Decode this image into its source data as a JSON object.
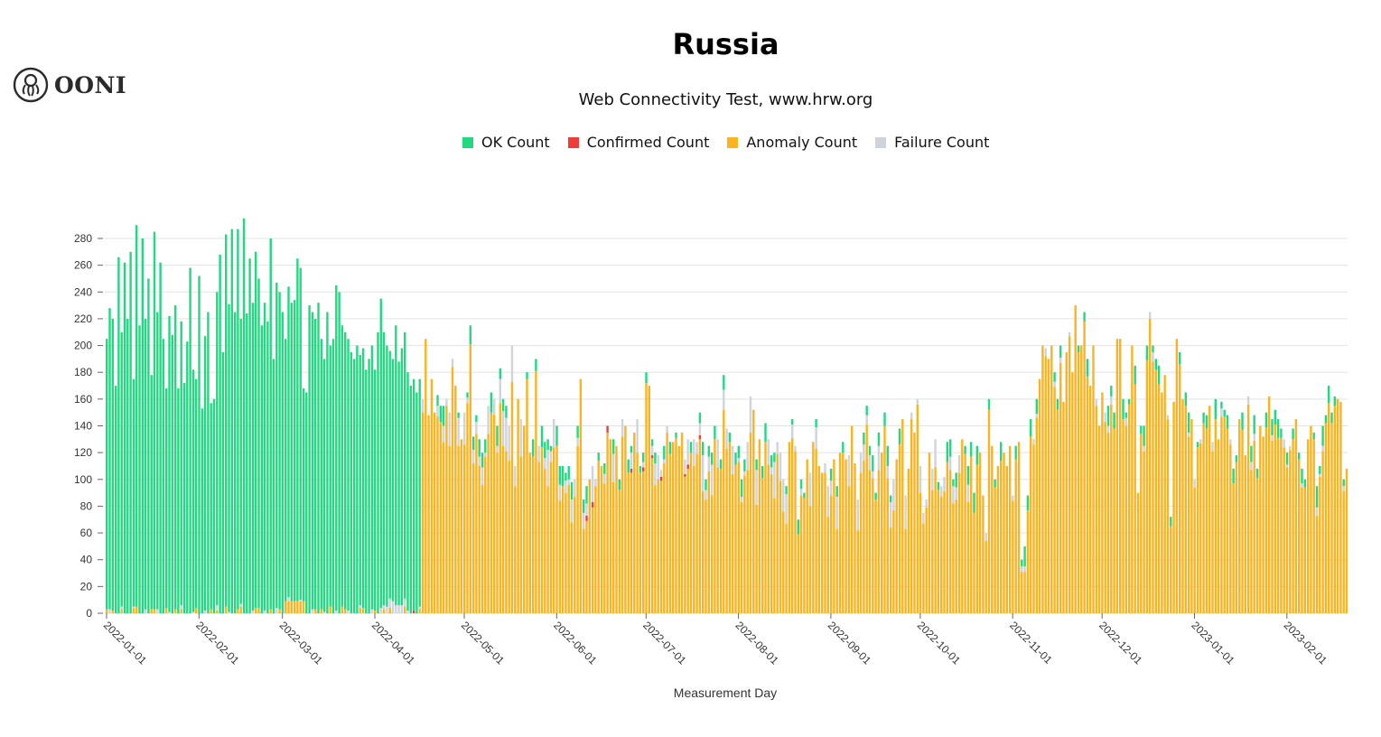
{
  "brand": {
    "name": "OONI",
    "icon": "octopus-logo-icon"
  },
  "chart_data": {
    "type": "bar",
    "stacked": true,
    "title": "Russia",
    "subtitle": "Web Connectivity Test, www.hrw.org",
    "xlabel": "Measurement Day",
    "ylabel": "",
    "ylim": [
      0,
      295
    ],
    "yticks": [
      0,
      20,
      40,
      60,
      80,
      100,
      120,
      140,
      160,
      180,
      200,
      220,
      240,
      260,
      280
    ],
    "grid": true,
    "legend_position": "top",
    "start_date": "2022-01-01",
    "xtick_labels": [
      "2022-01-01",
      "2022-02-01",
      "2022-03-01",
      "2022-04-01",
      "2022-05-01",
      "2022-06-01",
      "2022-07-01",
      "2022-08-01",
      "2022-09-01",
      "2022-10-01",
      "2022-11-01",
      "2022-12-01",
      "2023-01-01",
      "2023-02-01"
    ],
    "xtick_day_index": [
      0,
      31,
      59,
      90,
      120,
      151,
      181,
      212,
      243,
      273,
      304,
      334,
      365,
      396
    ],
    "series": [
      {
        "name": "OK Count",
        "color": "#22d982"
      },
      {
        "name": "Confirmed Count",
        "color": "#f03b3b"
      },
      {
        "name": "Anomaly Count",
        "color": "#fbb41f"
      },
      {
        "name": "Failure Count",
        "color": "#ced4da"
      }
    ],
    "daily_totals": [
      205,
      228,
      220,
      170,
      266,
      210,
      262,
      220,
      270,
      175,
      290,
      215,
      280,
      220,
      250,
      178,
      285,
      225,
      262,
      205,
      168,
      222,
      208,
      230,
      168,
      218,
      172,
      203,
      258,
      182,
      175,
      252,
      153,
      207,
      225,
      157,
      160,
      240,
      268,
      195,
      283,
      231,
      287,
      225,
      287,
      220,
      295,
      224,
      265,
      232,
      270,
      250,
      215,
      232,
      218,
      280,
      190,
      247,
      240,
      225,
      205,
      244,
      232,
      234,
      265,
      258,
      168,
      165,
      230,
      225,
      220,
      232,
      205,
      190,
      225,
      200,
      205,
      245,
      240,
      215,
      210,
      205,
      195,
      190,
      200,
      193,
      198,
      182,
      190,
      200,
      182,
      210,
      235,
      210,
      200,
      196,
      190,
      215,
      188,
      198,
      210,
      180,
      170,
      175,
      165,
      175,
      160,
      205,
      148,
      175,
      150,
      163,
      155,
      155,
      160,
      150,
      190,
      170,
      150,
      130,
      150,
      165,
      215,
      132,
      148,
      130,
      120,
      130,
      155,
      165,
      160,
      140,
      183,
      160,
      155,
      140,
      200,
      110,
      160,
      145,
      140,
      180,
      120,
      130,
      190,
      125,
      140,
      128,
      130,
      125,
      145,
      140,
      110,
      110,
      105,
      110,
      98,
      100,
      140,
      175,
      85,
      95,
      100,
      110,
      100,
      120,
      110,
      112,
      140,
      130,
      130,
      125,
      100,
      145,
      140,
      115,
      125,
      135,
      145,
      110,
      120,
      180,
      170,
      130,
      120,
      118,
      107,
      125,
      140,
      128,
      128,
      135,
      125,
      135,
      115,
      130,
      128,
      130,
      128,
      150,
      128,
      100,
      125,
      120,
      140,
      130,
      115,
      178,
      138,
      135,
      125,
      120,
      125,
      100,
      115,
      128,
      162,
      152,
      115,
      130,
      110,
      142,
      130,
      118,
      120,
      128,
      120,
      100,
      95,
      128,
      145,
      125,
      70,
      100,
      90,
      115,
      105,
      128,
      145,
      110,
      105,
      112,
      95,
      108,
      115,
      95,
      120,
      128,
      115,
      118,
      140,
      112,
      85,
      120,
      135,
      155,
      125,
      118,
      90,
      135,
      120,
      150,
      125,
      88,
      100,
      115,
      138,
      145,
      88,
      108,
      150,
      135,
      160,
      110,
      75,
      85,
      120,
      108,
      130,
      98,
      95,
      102,
      128,
      130,
      100,
      105,
      118,
      130,
      125,
      110,
      128,
      90,
      125,
      120,
      88,
      60,
      160,
      125,
      100,
      110,
      128,
      120,
      110,
      125,
      88,
      125,
      128,
      40,
      50,
      88,
      145,
      130,
      160,
      175,
      200,
      198,
      190,
      200,
      180,
      160,
      200,
      158,
      195,
      210,
      180,
      230,
      200,
      200,
      225,
      190,
      170,
      200,
      160,
      140,
      165,
      150,
      155,
      170,
      150,
      205,
      205,
      160,
      150,
      160,
      200,
      185,
      90,
      140,
      140,
      200,
      225,
      200,
      190,
      185,
      165,
      178,
      148,
      72,
      158,
      205,
      195,
      160,
      165,
      150,
      145,
      100,
      128,
      130,
      150,
      148,
      155,
      128,
      160,
      130,
      158,
      152,
      148,
      130,
      108,
      118,
      145,
      150,
      118,
      162,
      125,
      148,
      108,
      140,
      132,
      150,
      162,
      145,
      152,
      145,
      138,
      130,
      120,
      125,
      138,
      145,
      120,
      108,
      100,
      130,
      140,
      135,
      95,
      110,
      140,
      148,
      170,
      150,
      162,
      160,
      158,
      100,
      108
    ],
    "anomaly_start_index": 106,
    "confirmed_days": {
      "161": 4,
      "163": 4,
      "168": 5,
      "176": 3,
      "180": 3,
      "183": 2,
      "186": 3,
      "194": 2,
      "195": 3,
      "199": 3,
      "103": 2
    },
    "notes": "OK counts dominate through ~2022-04-16; afterwards anomaly counts dominate with small OK and failure caps"
  }
}
